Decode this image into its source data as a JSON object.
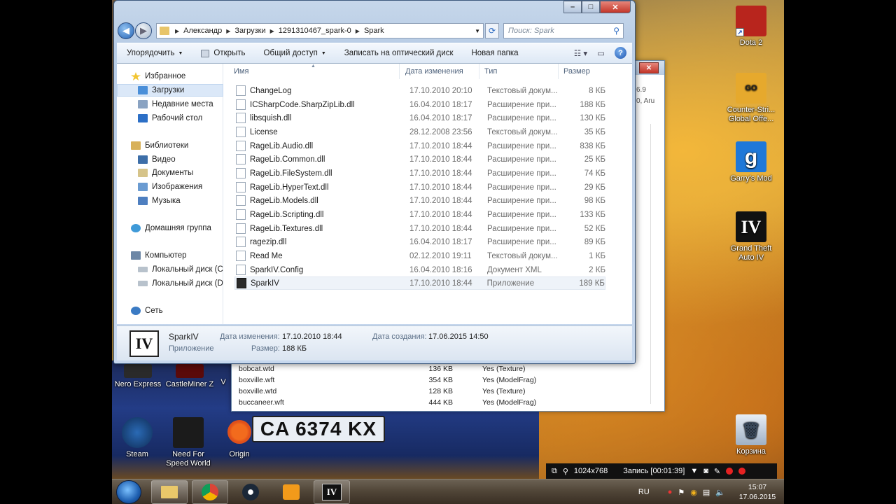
{
  "window": {
    "breadcrumb": [
      "Александр",
      "Загрузки",
      "1291310467_spark-0",
      "Spark"
    ],
    "search_placeholder": "Поиск: Spark",
    "controls": {
      "minimize": "–",
      "maximize": "□",
      "close": "✕"
    }
  },
  "toolbar": {
    "organize": "Упорядочить",
    "open": "Открыть",
    "share": "Общий доступ",
    "burn": "Записать на оптический диск",
    "new_folder": "Новая папка"
  },
  "nav": {
    "favorites": "Избранное",
    "downloads": "Загрузки",
    "recent": "Недавние места",
    "desktop": "Рабочий стол",
    "libraries": "Библиотеки",
    "video": "Видео",
    "documents": "Документы",
    "images": "Изображения",
    "music": "Музыка",
    "homegroup": "Домашняя группа",
    "computer": "Компьютер",
    "disk_c": "Локальный диск (C",
    "disk_d": "Локальный диск (D",
    "network": "Сеть"
  },
  "columns": {
    "name": "Имя",
    "date": "Дата изменения",
    "type": "Тип",
    "size": "Размер"
  },
  "files": [
    {
      "name": "ChangeLog",
      "date": "17.10.2010 20:10",
      "type": "Текстовый докум...",
      "size": "8 КБ"
    },
    {
      "name": "ICSharpCode.SharpZipLib.dll",
      "date": "16.04.2010 18:17",
      "type": "Расширение при...",
      "size": "188 КБ"
    },
    {
      "name": "libsquish.dll",
      "date": "16.04.2010 18:17",
      "type": "Расширение при...",
      "size": "130 КБ"
    },
    {
      "name": "License",
      "date": "28.12.2008 23:56",
      "type": "Текстовый докум...",
      "size": "35 КБ"
    },
    {
      "name": "RageLib.Audio.dll",
      "date": "17.10.2010 18:44",
      "type": "Расширение при...",
      "size": "838 КБ"
    },
    {
      "name": "RageLib.Common.dll",
      "date": "17.10.2010 18:44",
      "type": "Расширение при...",
      "size": "25 КБ"
    },
    {
      "name": "RageLib.FileSystem.dll",
      "date": "17.10.2010 18:44",
      "type": "Расширение при...",
      "size": "74 КБ"
    },
    {
      "name": "RageLib.HyperText.dll",
      "date": "17.10.2010 18:44",
      "type": "Расширение при...",
      "size": "29 КБ"
    },
    {
      "name": "RageLib.Models.dll",
      "date": "17.10.2010 18:44",
      "type": "Расширение при...",
      "size": "98 КБ"
    },
    {
      "name": "RageLib.Scripting.dll",
      "date": "17.10.2010 18:44",
      "type": "Расширение при...",
      "size": "133 КБ"
    },
    {
      "name": "RageLib.Textures.dll",
      "date": "17.10.2010 18:44",
      "type": "Расширение при...",
      "size": "52 КБ"
    },
    {
      "name": "ragezip.dll",
      "date": "16.04.2010 18:17",
      "type": "Расширение при...",
      "size": "89 КБ"
    },
    {
      "name": "Read Me",
      "date": "02.12.2010 19:11",
      "type": "Текстовый докум...",
      "size": "1 КБ"
    },
    {
      "name": "SparkIV.Config",
      "date": "16.04.2010 18:16",
      "type": "Документ XML",
      "size": "2 КБ"
    },
    {
      "name": "SparkIV",
      "date": "17.10.2010 18:44",
      "type": "Приложение",
      "size": "189 КБ"
    }
  ],
  "details": {
    "icon_text": "IV",
    "name": "SparkIV",
    "kind": "Приложение",
    "modified_label": "Дата изменения:",
    "modified": "17.10.2010 18:44",
    "size_label": "Размер:",
    "size": "188 КБ",
    "created_label": "Дата создания:",
    "created": "17.06.2015 14:50"
  },
  "bg_window": {
    "side_text_1": "6.9",
    "side_text_2": "0, Aru",
    "rows": [
      {
        "name": "bobcat.wtd",
        "size": "136 KB",
        "type": "Yes (Texture)"
      },
      {
        "name": "boxville.wft",
        "size": "354 KB",
        "type": "Yes (ModelFrag)"
      },
      {
        "name": "boxville.wtd",
        "size": "128 KB",
        "type": "Yes (Texture)"
      },
      {
        "name": "buccaneer.wft",
        "size": "444 KB",
        "type": "Yes (ModelFrag)"
      }
    ]
  },
  "desktop_icons": {
    "dota": "Dota 2",
    "csgo_l1": "Counter-Stri...",
    "csgo_l2": "Global Offe...",
    "gmod": "Garry's Mod",
    "gta_l1": "Grand Theft",
    "gta_l2": "Auto IV",
    "bin": "Корзина",
    "steam": "Steam",
    "nfs_l1": "Need For",
    "nfs_l2": "Speed World",
    "origin": "Origin",
    "nero": "Nero Express",
    "castleminer": "CastleMiner Z",
    "v_partial": "V"
  },
  "icon_glyphs": {
    "csgo": "GO",
    "gmod": "g",
    "gta": "IV",
    "bin": "🗑"
  },
  "plate_text": "CA 6374 KX",
  "recorder": {
    "resolution": "1024x768",
    "recording": "Запись [00:01:39]"
  },
  "tray": {
    "lang": "RU",
    "time": "15:07",
    "date": "17.06.2015"
  },
  "colors": {
    "selection": "#dbe8f8",
    "accent": "#1f56b0",
    "close": "#c3362a"
  }
}
